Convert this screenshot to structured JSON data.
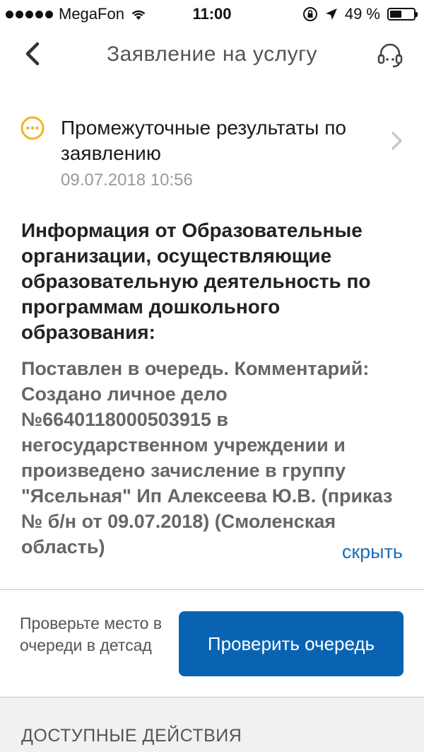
{
  "status_bar": {
    "carrier": "MegaFon",
    "time": "11:00",
    "battery_text": "49 %",
    "battery_level": 0.49
  },
  "nav": {
    "title": "Заявление на услугу"
  },
  "status": {
    "title": "Промежуточные результаты по заявлению",
    "date": "09.07.2018 10:56",
    "indicator_color": "#f0b429"
  },
  "info": {
    "heading": "Информация от Образовательные организации, осуществляющие образовательную деятельность по программам дошкольного образования:",
    "body": "Поставлен в очередь. Комментарий: Создано личное дело №6640118000503915 в негосударственном учреждении и произведено зачисление в группу \"Ясельная\" Ип Алексеева Ю.В. (приказ № б/н от 09.07.2018) (Смоленская область)",
    "hide_label": "скрыть"
  },
  "queue": {
    "hint": "Проверьте место в очереди в детсад",
    "button_label": "Проверить очередь"
  },
  "actions": {
    "title": "ДОСТУПНЫЕ ДЕЙСТВИЯ"
  },
  "colors": {
    "accent": "#0a63b2",
    "link": "#1c6eb5",
    "pending": "#f0b429"
  }
}
